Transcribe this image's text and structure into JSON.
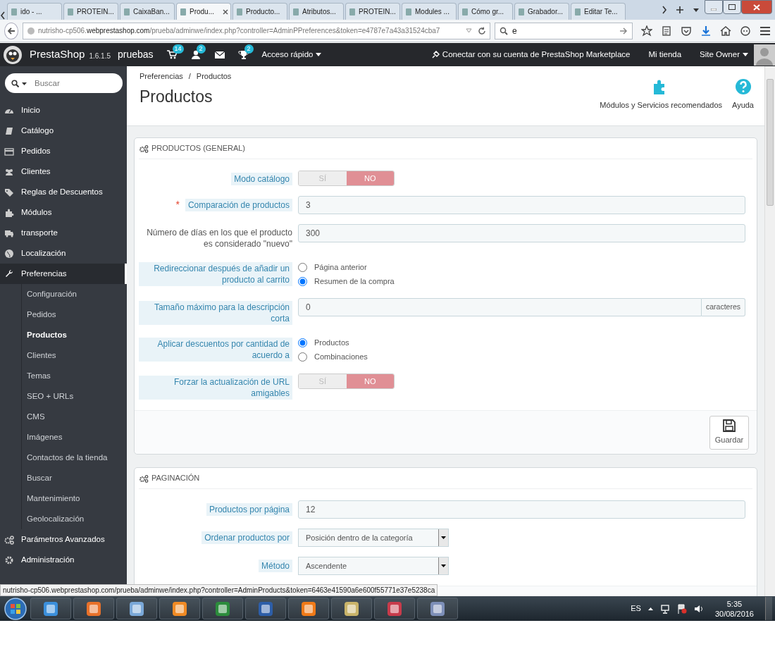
{
  "browser": {
    "tabs": [
      {
        "title": "ido - ...",
        "selected": false
      },
      {
        "title": "PROTEIN...",
        "selected": false
      },
      {
        "title": "CaixaBan...",
        "selected": false
      },
      {
        "title": "Produ...",
        "selected": true
      },
      {
        "title": "Producto...",
        "selected": false
      },
      {
        "title": "Atributos...",
        "selected": false
      },
      {
        "title": "PROTEIN...",
        "selected": false
      },
      {
        "title": "Modules ...",
        "selected": false
      },
      {
        "title": "Cómo gr...",
        "selected": false
      },
      {
        "title": "Grabador...",
        "selected": false
      },
      {
        "title": "Editar Te...",
        "selected": false
      }
    ],
    "url": "nutrisho-cp506.**webprestashop.com**/prueba/adminwe/index.php?controller=AdminPPreferences&token=e4787e7a43a31524cba7",
    "search_value": "e"
  },
  "navbar": {
    "brand": "PrestaShop",
    "version": "1.6.1.5",
    "shop": "pruebas",
    "notifications": [
      {
        "kind": "cart",
        "count": "14"
      },
      {
        "kind": "customer",
        "count": "2"
      },
      {
        "kind": "message"
      },
      {
        "kind": "trophy",
        "count": "2"
      }
    ],
    "quick_access": "Acceso rápido",
    "marketplace": "Conectar con su cuenta de PrestaShop Marketplace",
    "shop_link": "Mi tienda",
    "employee": "Site Owner"
  },
  "sidebar": {
    "search_placeholder": "Buscar",
    "items": [
      {
        "label": "Inicio",
        "selected": false
      },
      {
        "label": "Catálogo",
        "selected": false
      },
      {
        "label": "Pedidos",
        "selected": false
      },
      {
        "label": "Clientes",
        "selected": false
      },
      {
        "label": "Reglas de Descuentos",
        "selected": false
      },
      {
        "label": "Módulos",
        "selected": false
      },
      {
        "label": "transporte",
        "selected": false
      },
      {
        "label": "Localización",
        "selected": false
      },
      {
        "label": "Preferencias",
        "selected": true,
        "children": [
          {
            "label": "Configuración",
            "selected": false
          },
          {
            "label": "Pedidos",
            "selected": false
          },
          {
            "label": "Productos",
            "selected": true
          },
          {
            "label": "Clientes",
            "selected": false
          },
          {
            "label": "Temas",
            "selected": false
          },
          {
            "label": "SEO + URLs",
            "selected": false
          },
          {
            "label": "CMS",
            "selected": false
          },
          {
            "label": "Imágenes",
            "selected": false
          },
          {
            "label": "Contactos de la tienda",
            "selected": false
          },
          {
            "label": "Buscar",
            "selected": false
          },
          {
            "label": "Mantenimiento",
            "selected": false
          },
          {
            "label": "Geolocalización",
            "selected": false
          }
        ]
      },
      {
        "label": "Parámetros Avanzados",
        "selected": false
      },
      {
        "label": "Administración",
        "selected": false
      }
    ]
  },
  "header": {
    "breadcrumb": [
      "Preferencias",
      "Productos"
    ],
    "breadcrumb_separator": "/",
    "title": "Productos",
    "toolbar": [
      {
        "kind": "modules",
        "label": "Módulos y Servicios recomendados"
      },
      {
        "kind": "help",
        "label": "Ayuda"
      }
    ]
  },
  "panels": [
    {
      "title": "PRODUCTOS (GENERAL)",
      "save_label": "Guardar",
      "fields": [
        {
          "kind": "switch",
          "label": "Modo catálogo",
          "hint": true,
          "options": [
            {
              "label": "SÍ",
              "selected": false
            },
            {
              "label": "NO",
              "selected": true
            }
          ]
        },
        {
          "kind": "text",
          "label": "Comparación de productos",
          "hint": true,
          "required_mark": "*",
          "value": "3"
        },
        {
          "kind": "text",
          "label": "Número de días en los que el producto es considerado \"nuevo\"",
          "hint": false,
          "value": "300"
        },
        {
          "kind": "radio",
          "label": "Redireccionar después de añadir un producto al carrito",
          "hint": true,
          "options": [
            {
              "label": "Página anterior",
              "selected": false
            },
            {
              "label": "Resumen de la compra",
              "selected": true
            }
          ]
        },
        {
          "kind": "addon",
          "label": "Tamaño máximo para la descripción corta",
          "hint": true,
          "value": "0",
          "suffix": "caracteres"
        },
        {
          "kind": "radio",
          "label": "Aplicar descuentos por cantidad de acuerdo a",
          "hint": true,
          "options": [
            {
              "label": "Productos",
              "selected": true
            },
            {
              "label": "Combinaciones",
              "selected": false
            }
          ]
        },
        {
          "kind": "switch",
          "label": "Forzar la actualización de URL amigables",
          "hint": true,
          "options": [
            {
              "label": "SÍ",
              "selected": false
            },
            {
              "label": "NO",
              "selected": true
            }
          ]
        }
      ]
    },
    {
      "title": "PAGINACIÓN",
      "fields": [
        {
          "kind": "text",
          "label": "Productos por página",
          "hint": true,
          "value": "12"
        },
        {
          "kind": "select",
          "label": "Ordenar productos por",
          "hint": true,
          "value": "Posición dentro de la categoría"
        },
        {
          "kind": "select",
          "label": "Método",
          "hint": true,
          "value": "Ascendente"
        }
      ]
    }
  ],
  "status_url": "nutrisho-cp506.webprestashop.com/prueba/adminwe/index.php?controller=AdminProducts&token=6463e41590a6e600f55771e37e5238ca",
  "taskbar": {
    "language": "ES",
    "time": "5:35",
    "date": "30/08/2016"
  }
}
